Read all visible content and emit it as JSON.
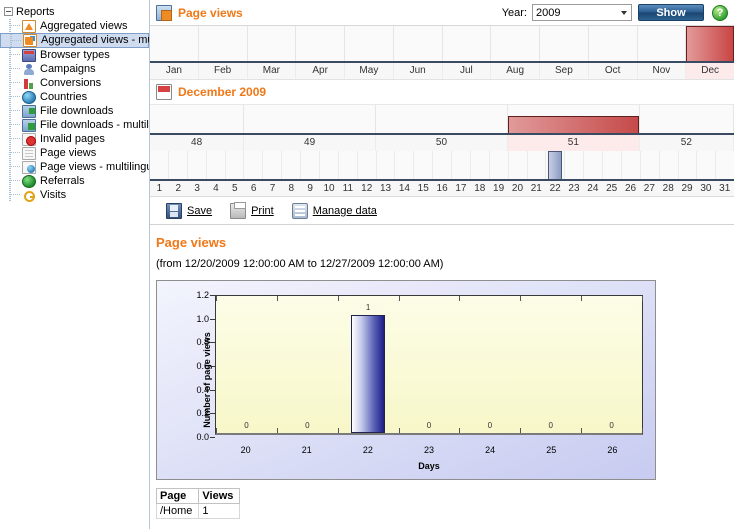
{
  "sidebar": {
    "root_label": "Reports",
    "items": [
      {
        "label": "Aggregated views",
        "icon": "rss-icon",
        "selected": false
      },
      {
        "label": "Aggregated views - mult",
        "icon": "rss-multilingual-icon",
        "selected": true
      },
      {
        "label": "Browser types",
        "icon": "browser-icon",
        "selected": false
      },
      {
        "label": "Campaigns",
        "icon": "person-icon",
        "selected": false
      },
      {
        "label": "Conversions",
        "icon": "bar-chart-icon",
        "selected": false
      },
      {
        "label": "Countries",
        "icon": "globe-icon",
        "selected": false
      },
      {
        "label": "File downloads",
        "icon": "download-icon",
        "selected": false
      },
      {
        "label": "File downloads - multilin",
        "icon": "download-multilingual-icon",
        "selected": false
      },
      {
        "label": "Invalid pages",
        "icon": "invalid-page-icon",
        "selected": false
      },
      {
        "label": "Page views",
        "icon": "page-icon",
        "selected": false
      },
      {
        "label": "Page views - multilingua",
        "icon": "page-multilingual-icon",
        "selected": false
      },
      {
        "label": "Referrals",
        "icon": "globe-green-icon",
        "selected": false
      },
      {
        "label": "Visits",
        "icon": "key-icon",
        "selected": false
      }
    ]
  },
  "header": {
    "title": "Page views",
    "icon": "report-icon",
    "year_label": "Year:",
    "year_value": "2009",
    "year_options": [
      "2009"
    ],
    "show_label": "Show",
    "help_label": "?"
  },
  "months": {
    "labels": [
      "Jan",
      "Feb",
      "Mar",
      "Apr",
      "May",
      "Jun",
      "Jul",
      "Aug",
      "Sep",
      "Oct",
      "Nov",
      "Dec"
    ],
    "selected_index": 11,
    "bar_heights_pct": [
      0,
      0,
      0,
      0,
      0,
      0,
      0,
      0,
      0,
      0,
      0,
      100
    ]
  },
  "month_header": {
    "title": "December 2009",
    "icon": "calendar-icon"
  },
  "weeks": {
    "labels": [
      "48",
      "49",
      "50",
      "51",
      "52"
    ],
    "spans_days": [
      5,
      7,
      7,
      7,
      5
    ],
    "selected_index": 3
  },
  "days": {
    "labels": [
      "1",
      "2",
      "3",
      "4",
      "5",
      "6",
      "7",
      "8",
      "9",
      "10",
      "11",
      "12",
      "13",
      "14",
      "15",
      "16",
      "17",
      "18",
      "19",
      "20",
      "21",
      "22",
      "23",
      "24",
      "25",
      "26",
      "27",
      "28",
      "29",
      "30",
      "31"
    ],
    "values": [
      0,
      0,
      0,
      0,
      0,
      0,
      0,
      0,
      0,
      0,
      0,
      0,
      0,
      0,
      0,
      0,
      0,
      0,
      0,
      0,
      0,
      1,
      0,
      0,
      0,
      0,
      0,
      0,
      0,
      0,
      0
    ],
    "bar_day_index": 21
  },
  "actions": [
    {
      "label": "Save",
      "icon": "save-icon"
    },
    {
      "label": "Print",
      "icon": "print-icon"
    },
    {
      "label": "Manage data",
      "icon": "database-icon"
    }
  ],
  "report": {
    "title": "Page views",
    "range": "(from 12/20/2009 12:00:00 AM to 12/27/2009 12:00:00 AM)"
  },
  "chart_data": {
    "type": "bar",
    "title": "",
    "categories": [
      "20",
      "21",
      "22",
      "23",
      "24",
      "25",
      "26"
    ],
    "values": [
      0,
      0,
      1,
      0,
      0,
      0,
      0
    ],
    "data_labels": [
      "0",
      "0",
      "1",
      "0",
      "0",
      "0",
      "0"
    ],
    "xlabel": "Days",
    "ylabel": "Number of page views",
    "ylim": [
      0,
      1.2
    ],
    "yticks": [
      0.0,
      0.2,
      0.4,
      0.6,
      0.8,
      1.0,
      1.2
    ],
    "ytick_labels": [
      "0.0",
      "0.2",
      "0.4",
      "0.6",
      "0.8",
      "1.0",
      "1.2"
    ],
    "grid": false,
    "legend": false,
    "bar_color": "#1d1d86",
    "plot_bg": "#fdfde8"
  },
  "table": {
    "columns": [
      "Page",
      "Views"
    ],
    "rows": [
      [
        "/Home",
        "1"
      ]
    ]
  },
  "colors": {
    "accent_orange": "#f07818",
    "selected_red": "#c94545",
    "day_bar_blue": "#8d9cc4",
    "button_blue": "#2a5c8f"
  }
}
